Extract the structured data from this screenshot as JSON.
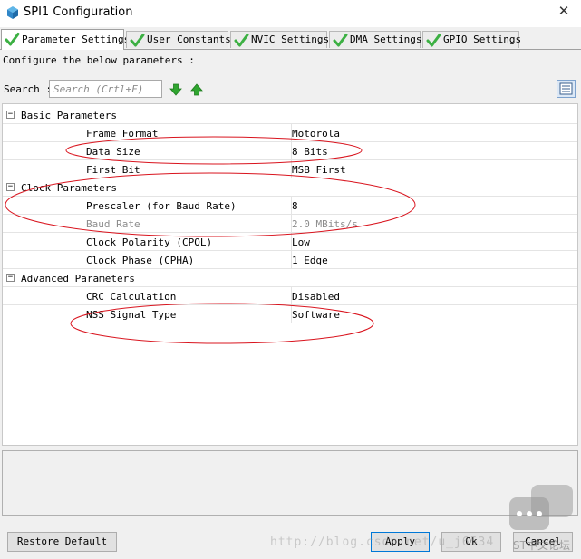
{
  "window": {
    "title": "SPI1 Configuration",
    "close_glyph": "✕"
  },
  "tabs": [
    {
      "label": "Parameter Settings",
      "active": true
    },
    {
      "label": "User Constants",
      "active": false
    },
    {
      "label": "NVIC Settings",
      "active": false
    },
    {
      "label": "DMA Settings",
      "active": false
    },
    {
      "label": "GPIO Settings",
      "active": false
    }
  ],
  "configure_text": "Configure the below parameters :",
  "search": {
    "label": "Search :",
    "placeholder": "Search (Crtl+F)",
    "value": ""
  },
  "groups": [
    {
      "name": "Basic Parameters",
      "toggle": "−",
      "params": [
        {
          "name": "Frame Format",
          "value": "Motorola",
          "enabled": true
        },
        {
          "name": "Data Size",
          "value": "8 Bits",
          "enabled": true
        },
        {
          "name": "First Bit",
          "value": "MSB First",
          "enabled": true
        }
      ]
    },
    {
      "name": "Clock Parameters",
      "toggle": "−",
      "params": [
        {
          "name": "Prescaler (for Baud Rate)",
          "value": "8",
          "enabled": true
        },
        {
          "name": "Baud Rate",
          "value": "2.0 MBits/s",
          "enabled": false
        },
        {
          "name": "Clock Polarity (CPOL)",
          "value": "Low",
          "enabled": true
        },
        {
          "name": "Clock Phase (CPHA)",
          "value": "1 Edge",
          "enabled": true
        }
      ]
    },
    {
      "name": "Advanced Parameters",
      "toggle": "−",
      "params": [
        {
          "name": "CRC Calculation",
          "value": "Disabled",
          "enabled": true
        },
        {
          "name": "NSS Signal Type",
          "value": "Software",
          "enabled": true
        }
      ]
    }
  ],
  "buttons": {
    "restore_default": "Restore Default",
    "apply": "Apply",
    "ok": "Ok",
    "cancel": "Cancel"
  },
  "watermark": {
    "url_text": "http://blog.csdn.net/u_j6534",
    "logo_text": "ST中文论坛"
  },
  "colors": {
    "tab_check": "#3cb043",
    "arrow_green": "#2fa52f",
    "annotation_red": "#d9141e",
    "disabled_text": "#8c8c8c"
  },
  "icons": {
    "app": "cube-icon",
    "tab": "check-icon",
    "search_next": "arrow-down-icon",
    "search_prev": "arrow-up-icon",
    "view": "list-view-icon"
  }
}
